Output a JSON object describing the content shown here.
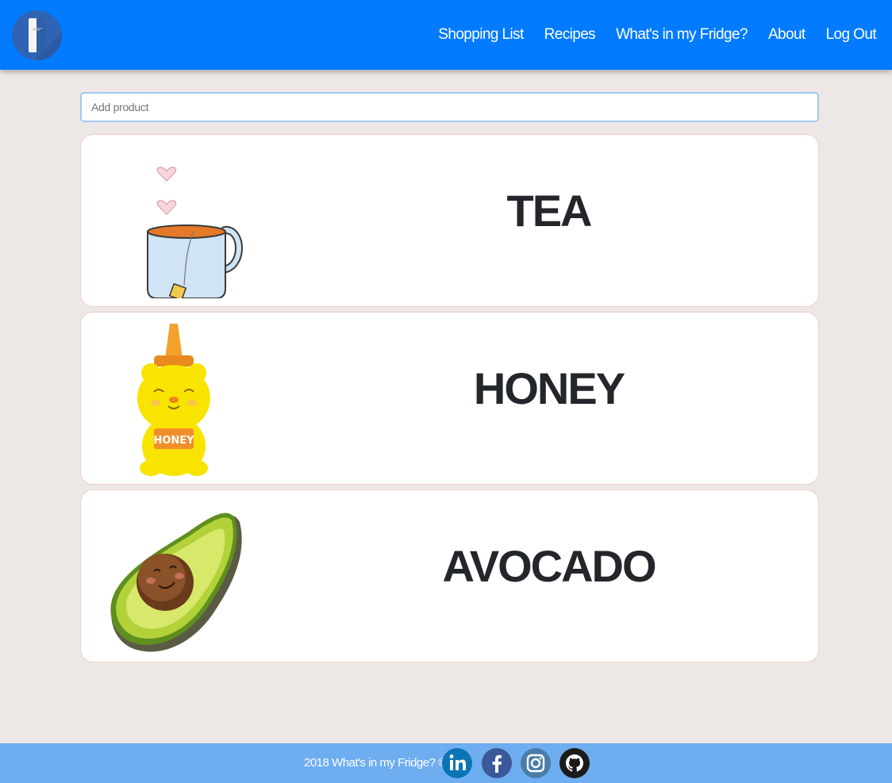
{
  "nav": {
    "logo_icon": "fridge-icon",
    "links": [
      "Shopping List",
      "Recipes",
      "What's in my Fridge?",
      "About",
      "Log Out"
    ]
  },
  "add_product": {
    "placeholder": "Add product",
    "value": ""
  },
  "products": [
    {
      "name": "TEA",
      "icon": "tea-mug-icon"
    },
    {
      "name": "HONEY",
      "icon": "honey-bear-icon"
    },
    {
      "name": "AVOCADO",
      "icon": "avocado-icon"
    }
  ],
  "footer": {
    "text": "2018 What's in my Fridge? ©",
    "social": [
      "linkedin-icon",
      "facebook-icon",
      "instagram-icon",
      "github-icon"
    ]
  },
  "colors": {
    "navbar": "#027bff",
    "footer": "#6eadf0",
    "background": "#ede8e5",
    "card_border": "#efd0cd"
  }
}
